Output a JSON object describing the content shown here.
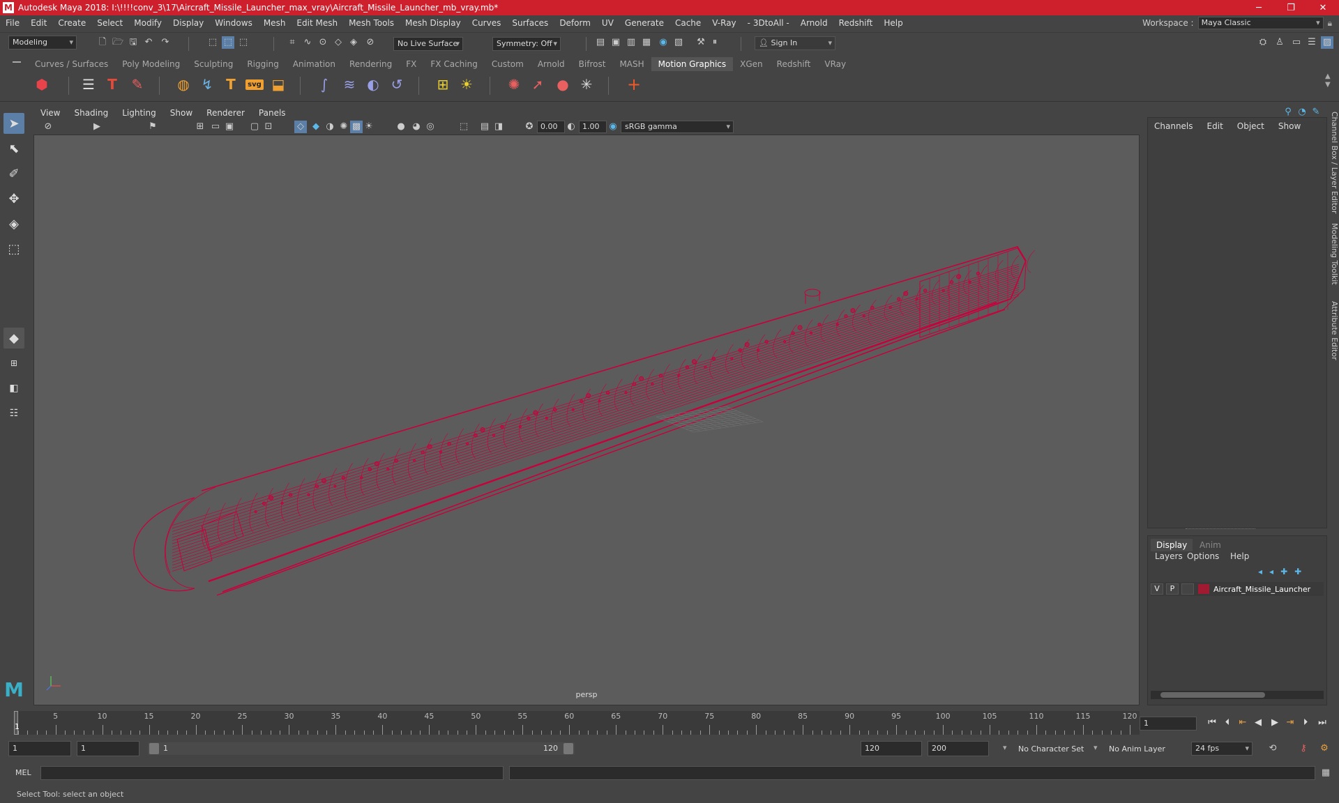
{
  "window": {
    "title": "Autodesk Maya 2018: I:\\!!!!conv_3\\17\\Aircraft_Missile_Launcher_max_vray\\Aircraft_Missile_Launcher_mb_vray.mb*",
    "logo": "M"
  },
  "menus": [
    "File",
    "Edit",
    "Create",
    "Select",
    "Modify",
    "Display",
    "Windows",
    "Mesh",
    "Edit Mesh",
    "Mesh Tools",
    "Mesh Display",
    "Curves",
    "Surfaces",
    "Deform",
    "UV",
    "Generate",
    "Cache",
    "V-Ray",
    "- 3DtoAll -",
    "Arnold",
    "Redshift",
    "Help"
  ],
  "workspace": {
    "label": "Workspace :",
    "value": "Maya Classic"
  },
  "statusline": {
    "mode": "Modeling",
    "live_surface": "No Live Surface",
    "symmetry": "Symmetry: Off",
    "sign_in": "Sign In"
  },
  "shelf": {
    "tabs": [
      "Curves / Surfaces",
      "Poly Modeling",
      "Sculpting",
      "Rigging",
      "Animation",
      "Rendering",
      "FX",
      "FX Caching",
      "Custom",
      "Arnold",
      "Bifrost",
      "MASH",
      "Motion Graphics",
      "XGen",
      "Redshift",
      "VRay"
    ],
    "active_tab": "Motion Graphics",
    "icons": [
      "cube-icon",
      "list-icon",
      "text-icon",
      "paint-icon",
      "sphere-icon",
      "curve-icon",
      "type-icon",
      "svg-icon",
      "box-icon",
      "sweep-icon",
      "wave-icon",
      "twist-icon",
      "spiral-icon",
      "grid-icon",
      "sun-icon",
      "gear-icon",
      "arrow-icon",
      "blob-icon",
      "burst-icon",
      "plus-icon"
    ],
    "svg_label": "svg"
  },
  "viewport": {
    "menus": [
      "View",
      "Shading",
      "Lighting",
      "Show",
      "Renderer",
      "Panels"
    ],
    "exposure": "0.00",
    "gamma": "1.00",
    "color_space": "sRGB gamma",
    "camera": "persp",
    "wire_color": "#c8003c"
  },
  "channel_box": {
    "menus": [
      "Channels",
      "Edit",
      "Object",
      "Show"
    ],
    "side_tabs": [
      "Channel Box / Layer Editor",
      "Modeling Toolkit",
      "Attribute Editor"
    ]
  },
  "layer_editor": {
    "tabs": [
      "Display",
      "Anim"
    ],
    "active_tab": "Display",
    "menus": [
      "Layers",
      "Options",
      "Help"
    ],
    "layer": {
      "visible": "V",
      "playback": "P",
      "name": "Aircraft_Missile_Launcher",
      "color": "#a01a32"
    }
  },
  "timeline": {
    "start": 1,
    "ticks": [
      5,
      10,
      15,
      20,
      25,
      30,
      35,
      40,
      45,
      50,
      55,
      60,
      65,
      70,
      75,
      80,
      85,
      90,
      95,
      100,
      105,
      110,
      115,
      120
    ],
    "current_frame": "1",
    "end": 120
  },
  "range": {
    "start_time": "1",
    "playback_start": "1",
    "slider_start": "1",
    "slider_end": "120",
    "playback_end": "120",
    "end_time": "200",
    "character_set": "No Character Set",
    "anim_layer": "No Anim Layer",
    "fps": "24 fps"
  },
  "commandline": {
    "label": "MEL"
  },
  "helpline": "Select Tool: select an object"
}
